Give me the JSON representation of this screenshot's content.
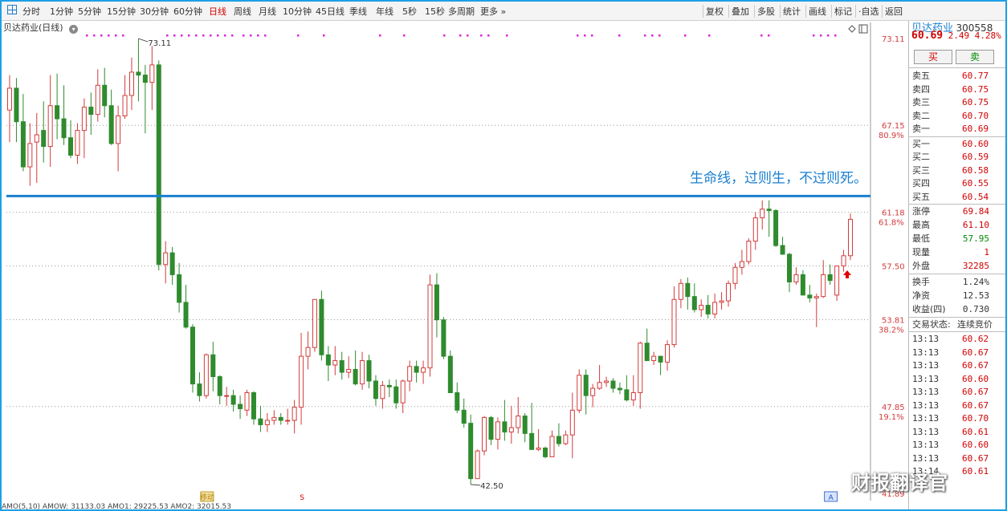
{
  "toolbar": {
    "left_items": [
      "分时",
      "1分钟",
      "5分钟",
      "15分钟",
      "30分钟",
      "60分钟",
      "日线",
      "周线",
      "月线",
      "10分钟",
      "45日线",
      "季线",
      "年线",
      "5秒",
      "15秒",
      "多周期",
      "更多 »"
    ],
    "active_index": 6,
    "right_items": [
      "复权",
      "叠加",
      "多股",
      "统计",
      "画线",
      "标记",
      "·自选",
      "返回"
    ]
  },
  "chart_title": "贝达药业(日线)",
  "annotation": "生命线，过则生，不过则死。",
  "price_axis": [
    {
      "price": "73.11",
      "pct": ""
    },
    {
      "price": "67.15",
      "pct": "80.9%"
    },
    {
      "price": "61.18",
      "pct": "61.8%"
    },
    {
      "price": "57.50",
      "pct": ""
    },
    {
      "price": "53.81",
      "pct": "38.2%"
    },
    {
      "price": "47.85",
      "pct": "19.1%"
    },
    {
      "price": "41.89",
      "pct": ""
    }
  ],
  "price_max": 73.11,
  "price_min": 41.89,
  "high_label": "73.11",
  "low_label": "42.50",
  "life_line_price": 62.3,
  "candles": [
    [
      68.2,
      70.6,
      66.0,
      69.7
    ],
    [
      69.7,
      70.4,
      66.0,
      67.4
    ],
    [
      67.4,
      69.3,
      64.0,
      64.3
    ],
    [
      64.3,
      67.3,
      63.0,
      65.9
    ],
    [
      66.0,
      68.0,
      63.2,
      66.5
    ],
    [
      66.8,
      68.8,
      64.6,
      65.7
    ],
    [
      65.7,
      70.6,
      64.3,
      68.5
    ],
    [
      68.5,
      70.7,
      66.2,
      67.6
    ],
    [
      67.6,
      69.9,
      65.8,
      66.3
    ],
    [
      66.3,
      67.5,
      64.9,
      65.1
    ],
    [
      65.1,
      67.3,
      64.5,
      66.8
    ],
    [
      66.8,
      69.0,
      64.9,
      68.4
    ],
    [
      68.4,
      69.4,
      66.5,
      67.9
    ],
    [
      67.9,
      71.0,
      67.4,
      69.9
    ],
    [
      69.9,
      71.1,
      67.7,
      68.5
    ],
    [
      68.5,
      69.6,
      65.8,
      65.9
    ],
    [
      65.9,
      68.5,
      64.0,
      67.8
    ],
    [
      67.8,
      70.6,
      67.6,
      69.2
    ],
    [
      69.2,
      71.8,
      68.2,
      70.8
    ],
    [
      70.8,
      73.1,
      68.8,
      70.6
    ],
    [
      70.6,
      71.3,
      66.6,
      70.1
    ],
    [
      70.1,
      72.6,
      68.2,
      71.3
    ],
    [
      71.3,
      71.6,
      57.2,
      57.6
    ],
    [
      57.6,
      59.2,
      56.3,
      58.4
    ],
    [
      58.4,
      58.8,
      56.2,
      56.9
    ],
    [
      56.9,
      57.7,
      54.3,
      55.0
    ],
    [
      55.0,
      56.2,
      53.2,
      53.3
    ],
    [
      53.3,
      53.5,
      48.8,
      49.4
    ],
    [
      49.4,
      50.2,
      48.2,
      48.6
    ],
    [
      48.6,
      51.5,
      48.4,
      51.4
    ],
    [
      51.4,
      52.3,
      48.9,
      49.9
    ],
    [
      49.9,
      50.0,
      48.0,
      48.6
    ],
    [
      48.6,
      49.2,
      47.9,
      48.6
    ],
    [
      48.6,
      49.0,
      47.5,
      48.0
    ],
    [
      48.0,
      48.6,
      47.0,
      47.7
    ],
    [
      47.6,
      49.0,
      47.2,
      48.8
    ],
    [
      48.8,
      48.9,
      46.6,
      47.0
    ],
    [
      47.0,
      47.9,
      46.1,
      46.6
    ],
    [
      46.6,
      47.4,
      46.1,
      46.9
    ],
    [
      46.9,
      47.6,
      46.6,
      47.1
    ],
    [
      47.1,
      47.4,
      46.6,
      46.9
    ],
    [
      46.9,
      47.7,
      46.6,
      46.9
    ],
    [
      46.9,
      48.3,
      46.0,
      47.8
    ],
    [
      47.8,
      52.9,
      46.6,
      51.3
    ],
    [
      51.3,
      53.0,
      50.4,
      51.9
    ],
    [
      51.9,
      55.2,
      51.6,
      55.2
    ],
    [
      55.2,
      55.8,
      51.0,
      51.4
    ],
    [
      51.4,
      52.0,
      49.6,
      50.7
    ],
    [
      50.7,
      52.0,
      50.0,
      51.0
    ],
    [
      51.0,
      51.6,
      49.7,
      50.2
    ],
    [
      50.2,
      51.3,
      49.8,
      50.4
    ],
    [
      50.4,
      51.7,
      49.3,
      49.4
    ],
    [
      49.4,
      51.6,
      49.0,
      51.0
    ],
    [
      51.0,
      51.4,
      49.1,
      49.6
    ],
    [
      49.6,
      50.0,
      47.9,
      48.4
    ],
    [
      48.4,
      49.6,
      47.7,
      49.3
    ],
    [
      49.3,
      49.7,
      48.5,
      49.2
    ],
    [
      49.2,
      49.7,
      47.7,
      48.1
    ],
    [
      48.1,
      49.7,
      47.4,
      49.6
    ],
    [
      49.6,
      51.0,
      48.9,
      50.6
    ],
    [
      50.6,
      51.0,
      49.5,
      50.2
    ],
    [
      50.2,
      51.0,
      49.4,
      50.5
    ],
    [
      50.5,
      56.9,
      49.9,
      56.2
    ],
    [
      56.2,
      57.0,
      52.6,
      53.8
    ],
    [
      53.8,
      54.0,
      51.1,
      51.3
    ],
    [
      51.3,
      51.7,
      48.8,
      48.8
    ],
    [
      48.8,
      49.5,
      47.4,
      47.6
    ],
    [
      47.6,
      48.4,
      46.4,
      46.7
    ],
    [
      46.7,
      47.3,
      42.5,
      42.9
    ],
    [
      42.9,
      44.9,
      42.9,
      44.8
    ],
    [
      44.8,
      47.2,
      44.5,
      47.1
    ],
    [
      47.1,
      47.2,
      45.2,
      45.6
    ],
    [
      45.6,
      47.1,
      44.9,
      46.8
    ],
    [
      46.8,
      48.3,
      45.5,
      46.1
    ],
    [
      46.1,
      47.9,
      45.3,
      46.4
    ],
    [
      46.4,
      48.5,
      46.0,
      47.2
    ],
    [
      47.2,
      47.4,
      45.4,
      46.0
    ],
    [
      46.0,
      48.1,
      45.0,
      44.9
    ],
    [
      44.9,
      46.3,
      44.8,
      45.0
    ],
    [
      45.0,
      45.1,
      44.3,
      44.4
    ],
    [
      44.4,
      46.2,
      44.4,
      45.8
    ],
    [
      45.8,
      46.7,
      45.1,
      45.3
    ],
    [
      45.3,
      46.2,
      45.2,
      45.9
    ],
    [
      45.9,
      48.8,
      44.3,
      47.6
    ],
    [
      47.6,
      50.4,
      47.4,
      50.0
    ],
    [
      50.0,
      50.4,
      47.3,
      48.6
    ],
    [
      48.6,
      49.4,
      47.8,
      49.1
    ],
    [
      49.1,
      50.7,
      49.0,
      49.5
    ],
    [
      49.5,
      49.9,
      49.2,
      49.6
    ],
    [
      49.6,
      49.8,
      48.8,
      49.1
    ],
    [
      49.1,
      49.5,
      48.7,
      49.0
    ],
    [
      49.0,
      50.0,
      48.2,
      48.3
    ],
    [
      48.3,
      50.0,
      47.9,
      48.8
    ],
    [
      48.8,
      52.3,
      47.7,
      52.2
    ],
    [
      52.2,
      53.2,
      51.4,
      51.0
    ],
    [
      51.0,
      51.6,
      50.7,
      51.3
    ],
    [
      51.3,
      51.3,
      50.0,
      50.9
    ],
    [
      50.9,
      52.4,
      50.3,
      52.1
    ],
    [
      52.1,
      56.1,
      51.9,
      55.2
    ],
    [
      55.2,
      56.6,
      54.6,
      56.3
    ],
    [
      56.3,
      56.7,
      54.5,
      55.4
    ],
    [
      55.4,
      56.3,
      54.3,
      54.5
    ],
    [
      54.5,
      55.2,
      54.0,
      54.8
    ],
    [
      54.8,
      55.5,
      53.9,
      54.2
    ],
    [
      54.2,
      55.6,
      53.9,
      55.0
    ],
    [
      55.0,
      55.7,
      54.5,
      55.1
    ],
    [
      55.1,
      56.5,
      54.7,
      56.3
    ],
    [
      56.3,
      57.7,
      55.9,
      57.4
    ],
    [
      57.4,
      58.6,
      56.9,
      57.8
    ],
    [
      57.8,
      59.4,
      57.6,
      59.2
    ],
    [
      59.2,
      61.2,
      58.6,
      60.8
    ],
    [
      60.8,
      62.0,
      60.0,
      61.4
    ],
    [
      61.4,
      62.0,
      59.5,
      61.3
    ],
    [
      61.3,
      61.4,
      58.8,
      58.9
    ],
    [
      58.9,
      59.5,
      58.3,
      58.3
    ],
    [
      58.3,
      58.4,
      55.7,
      56.4
    ],
    [
      56.4,
      57.4,
      56.2,
      56.9
    ],
    [
      56.9,
      57.2,
      55.5,
      55.5
    ],
    [
      55.5,
      56.2,
      55.0,
      55.3
    ],
    [
      55.3,
      55.6,
      53.3,
      55.4
    ],
    [
      55.4,
      57.9,
      55.3,
      56.9
    ],
    [
      56.9,
      57.6,
      56.2,
      56.5
    ],
    [
      55.5,
      57.4,
      55.1,
      57.5
    ],
    [
      57.5,
      58.6,
      57.1,
      58.2
    ],
    [
      58.2,
      61.1,
      57.9,
      60.7
    ]
  ],
  "markers": [
    {
      "label": "移动",
      "index": 29
    },
    {
      "label": "S",
      "index": 43
    },
    {
      "label": "A",
      "index": 121
    }
  ],
  "bottom_text": "AMO(5,10)  AMOW: 31133.03  AMO1: 29225.53  AMO2: 32015.53",
  "stock": {
    "name": "贝达药业",
    "code": "300558",
    "price": "60.69",
    "change": "2.49",
    "change_pct": "4.28%",
    "buy_label": "买",
    "sell_label": "卖"
  },
  "order_book": {
    "sell": [
      {
        "label": "卖五",
        "price": "60.77"
      },
      {
        "label": "卖四",
        "price": "60.75"
      },
      {
        "label": "卖三",
        "price": "60.75"
      },
      {
        "label": "卖二",
        "price": "60.70"
      },
      {
        "label": "卖一",
        "price": "60.69"
      }
    ],
    "buy": [
      {
        "label": "买一",
        "price": "60.60"
      },
      {
        "label": "买二",
        "price": "60.59"
      },
      {
        "label": "买三",
        "price": "60.58"
      },
      {
        "label": "买四",
        "price": "60.55"
      },
      {
        "label": "买五",
        "price": "60.54"
      }
    ]
  },
  "quote_stats": [
    {
      "label": "涨停",
      "value": "69.84",
      "color": "#d00000"
    },
    {
      "label": "最高",
      "value": "61.10",
      "color": "#d00000"
    },
    {
      "label": "最低",
      "value": "57.95",
      "color": "#008a00"
    },
    {
      "label": "现量",
      "value": "1",
      "color": "#d00000"
    },
    {
      "label": "外盘",
      "value": "32285",
      "color": "#d00000"
    }
  ],
  "extra_stats": [
    {
      "label": "换手",
      "value": "1.24%"
    },
    {
      "label": "净资",
      "value": "12.53"
    },
    {
      "label": "收益(四)",
      "value": "0.730"
    }
  ],
  "trade_status": {
    "label": "交易状态:",
    "value": "连续竞价"
  },
  "ticks": [
    {
      "time": "13:13",
      "price": "60.62"
    },
    {
      "time": "13:13",
      "price": "60.67"
    },
    {
      "time": "13:13",
      "price": "60.67"
    },
    {
      "time": "13:13",
      "price": "60.60"
    },
    {
      "time": "13:13",
      "price": "60.67"
    },
    {
      "time": "13:13",
      "price": "60.67"
    },
    {
      "time": "13:13",
      "price": "60.70"
    },
    {
      "time": "13:13",
      "price": "60.61"
    },
    {
      "time": "13:13",
      "price": "60.60"
    },
    {
      "time": "13:13",
      "price": "60.67"
    },
    {
      "time": "13:14",
      "price": "60.61"
    }
  ],
  "watermark": "财报翻译官",
  "colors": {
    "up": "#d23c3c",
    "down": "#2e8b2e",
    "life_line": "#1a7fd0",
    "annotation": "#1a7fd0",
    "accent": "#1ea0e6"
  }
}
